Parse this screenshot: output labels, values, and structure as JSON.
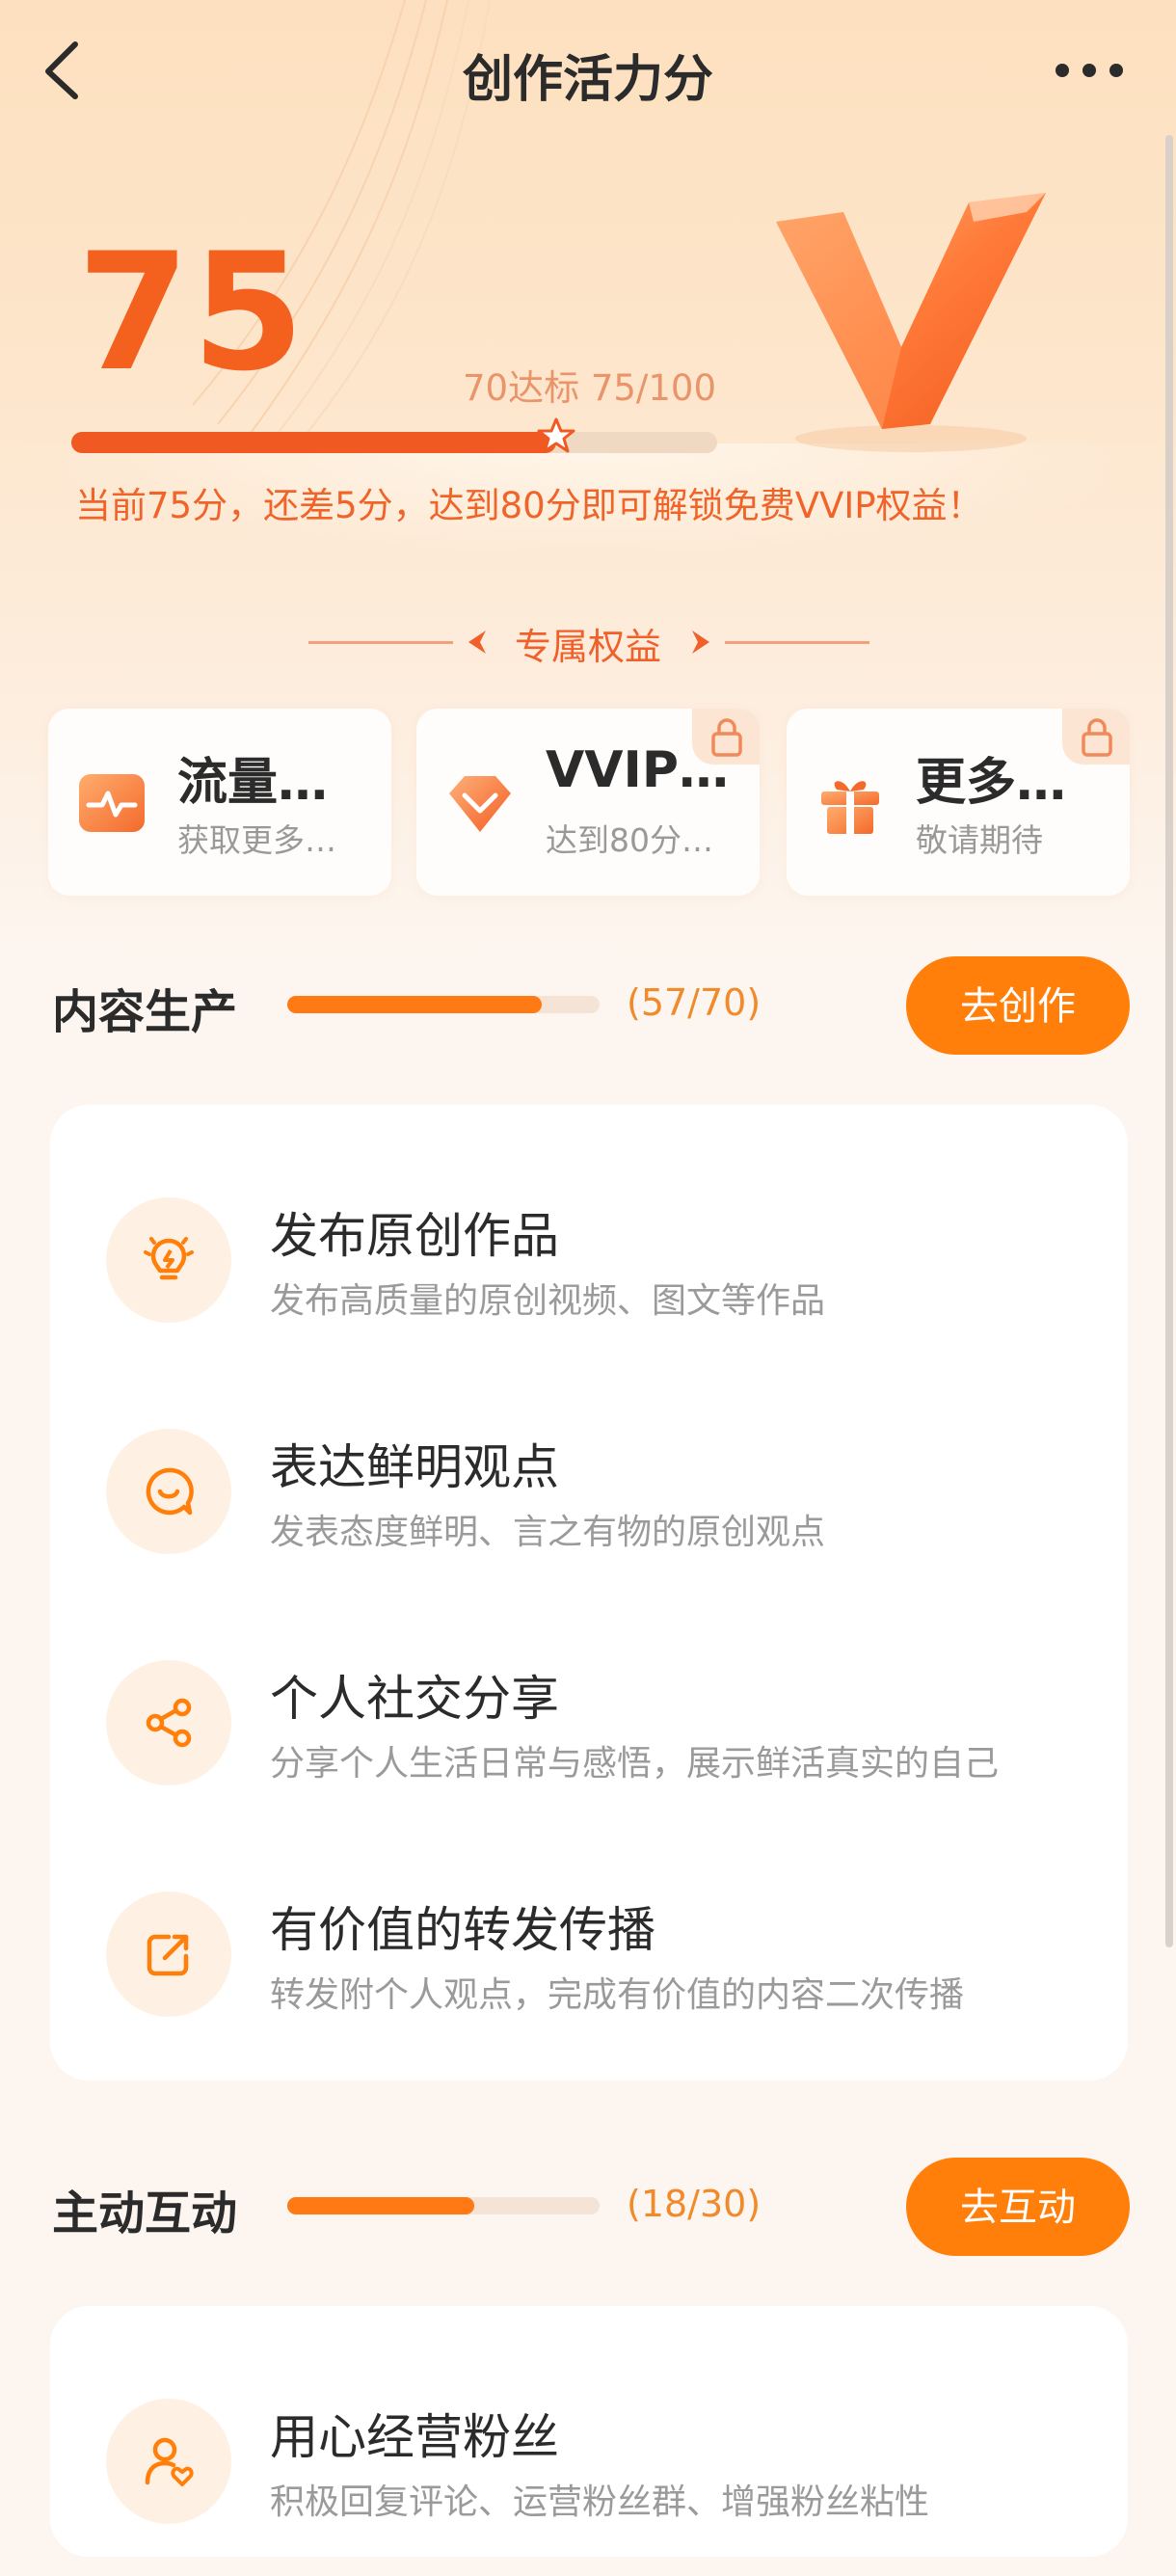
{
  "header": {
    "title": "创作活力分",
    "back_icon": "back-chevron-icon",
    "more_icon": "more-dots-icon"
  },
  "score": {
    "value": "75",
    "target_text": "70达标 75/100",
    "progress_fraction": 0.75,
    "hint": "当前75分，还差5分，达到80分即可解锁免费VVIP权益！"
  },
  "benefits": {
    "section_title": "专属权益",
    "items": [
      {
        "title": "流量…",
        "subtitle": "获取更多…",
        "icon": "pulse-icon",
        "locked": false
      },
      {
        "title": "VVIP…",
        "subtitle": "达到80分…",
        "icon": "diamond-icon",
        "locked": true
      },
      {
        "title": "更多…",
        "subtitle": "敬请期待",
        "icon": "gift-icon",
        "locked": true
      }
    ]
  },
  "sections": [
    {
      "title": "内容生产",
      "count": "(57/70)",
      "progress_fraction": 0.814,
      "button": "去创作",
      "tasks": [
        {
          "title": "发布原创作品",
          "subtitle": "发布高质量的原创视频、图文等作品",
          "icon": "lightbulb-icon"
        },
        {
          "title": "表达鲜明观点",
          "subtitle": "发表态度鲜明、言之有物的原创观点",
          "icon": "smile-chat-icon"
        },
        {
          "title": "个人社交分享",
          "subtitle": "分享个人生活日常与感悟，展示鲜活真实的自己",
          "icon": "share-icon"
        },
        {
          "title": "有价值的转发传播",
          "subtitle": "转发附个人观点，完成有价值的内容二次传播",
          "icon": "forward-icon"
        }
      ]
    },
    {
      "title": "主动互动",
      "count": "(18/30)",
      "progress_fraction": 0.6,
      "button": "去互动",
      "tasks": [
        {
          "title": "用心经营粉丝",
          "subtitle": "积极回复评论、运营粉丝群、增强粉丝粘性",
          "icon": "user-heart-icon"
        }
      ]
    }
  ],
  "colors": {
    "accent": "#ff7f0a",
    "score": "#f4601e",
    "background": "#fdf6f0"
  }
}
